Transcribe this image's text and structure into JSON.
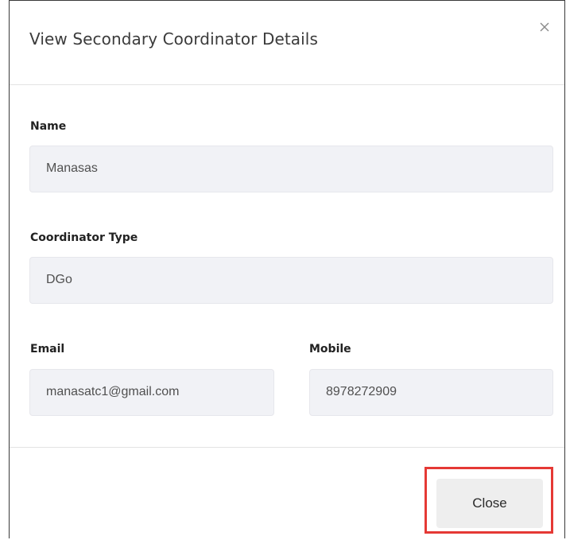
{
  "modal": {
    "title": "View Secondary Coordinator Details",
    "close_icon": "close-icon"
  },
  "fields": {
    "name": {
      "label": "Name",
      "value": "Manasas"
    },
    "coordinator_type": {
      "label": "Coordinator Type",
      "value": "DGo"
    },
    "email": {
      "label": "Email",
      "value": "manasatc1@gmail.com"
    },
    "mobile": {
      "label": "Mobile",
      "value": "8978272909"
    }
  },
  "footer": {
    "close_label": "Close",
    "highlight_color": "#e53935"
  }
}
